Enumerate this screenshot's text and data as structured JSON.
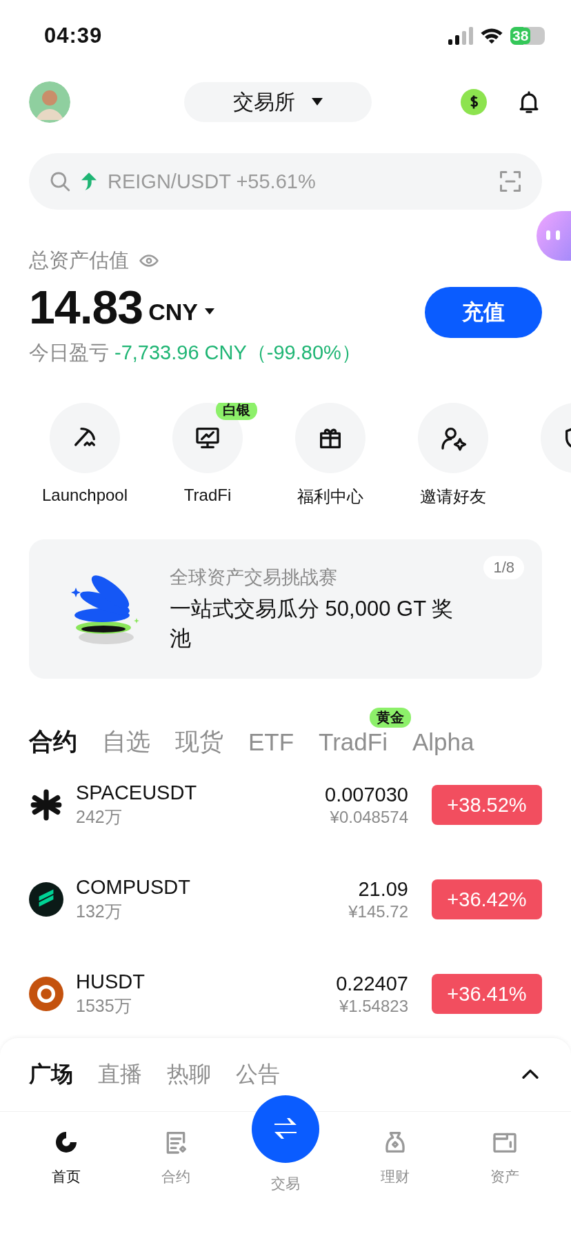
{
  "status_bar": {
    "time": "04:39",
    "battery": "38"
  },
  "header": {
    "exchange": "交易所"
  },
  "search": {
    "placeholder": "REIGN/USDT +55.61%"
  },
  "assets": {
    "title": "总资产估值",
    "value": "14.83",
    "currency": "CNY",
    "deposit": "充值",
    "pnl_label": "今日盈亏",
    "pnl_value": "-7,733.96 CNY（-99.80%）"
  },
  "shortcuts": [
    {
      "kind": "launchpool",
      "label": "Launchpool"
    },
    {
      "kind": "tradfi",
      "label": "TradFi",
      "badge": "白银"
    },
    {
      "kind": "gift",
      "label": "福利中心"
    },
    {
      "kind": "invite",
      "label": "邀请好友"
    },
    {
      "kind": "copy"
    }
  ],
  "banner": {
    "subtitle": "全球资产交易挑战赛",
    "title": "一站式交易瓜分 50,000 GT 奖池",
    "pager": "1/8"
  },
  "market_tabs": [
    {
      "label": "合约",
      "selected": true
    },
    {
      "label": "自选",
      "selected": false
    },
    {
      "label": "现货",
      "selected": false
    },
    {
      "label": "ETF",
      "selected": false
    },
    {
      "label": "TradFi",
      "selected": false,
      "badge": "黄金"
    },
    {
      "label": "Alpha",
      "selected": false
    }
  ],
  "tickers": [
    {
      "kind": "star",
      "name": "SPACEUSDT",
      "volume": "242万",
      "price": "0.007030",
      "cny": "¥0.048574",
      "change": "+38.52%"
    },
    {
      "kind": "comp",
      "name": "COMPUSDT",
      "volume": "132万",
      "price": "21.09",
      "cny": "¥145.72",
      "change": "+36.42%"
    },
    {
      "kind": "flower",
      "name": "HUSDT",
      "volume": "1535万",
      "price": "0.22407",
      "cny": "¥1.54823",
      "change": "+36.41%"
    }
  ],
  "feed_tabs": [
    {
      "label": "广场",
      "selected": true
    },
    {
      "label": "直播",
      "selected": false
    },
    {
      "label": "热聊",
      "selected": false
    },
    {
      "label": "公告",
      "selected": false
    }
  ],
  "nav": [
    {
      "kind": "home",
      "label": "首页",
      "selected": true
    },
    {
      "kind": "futures",
      "label": "合约",
      "selected": false
    },
    {
      "kind": "trade",
      "label": "交易",
      "selected": false
    },
    {
      "kind": "earn",
      "label": "理财",
      "selected": false
    },
    {
      "kind": "wallet",
      "label": "资产",
      "selected": false
    }
  ]
}
